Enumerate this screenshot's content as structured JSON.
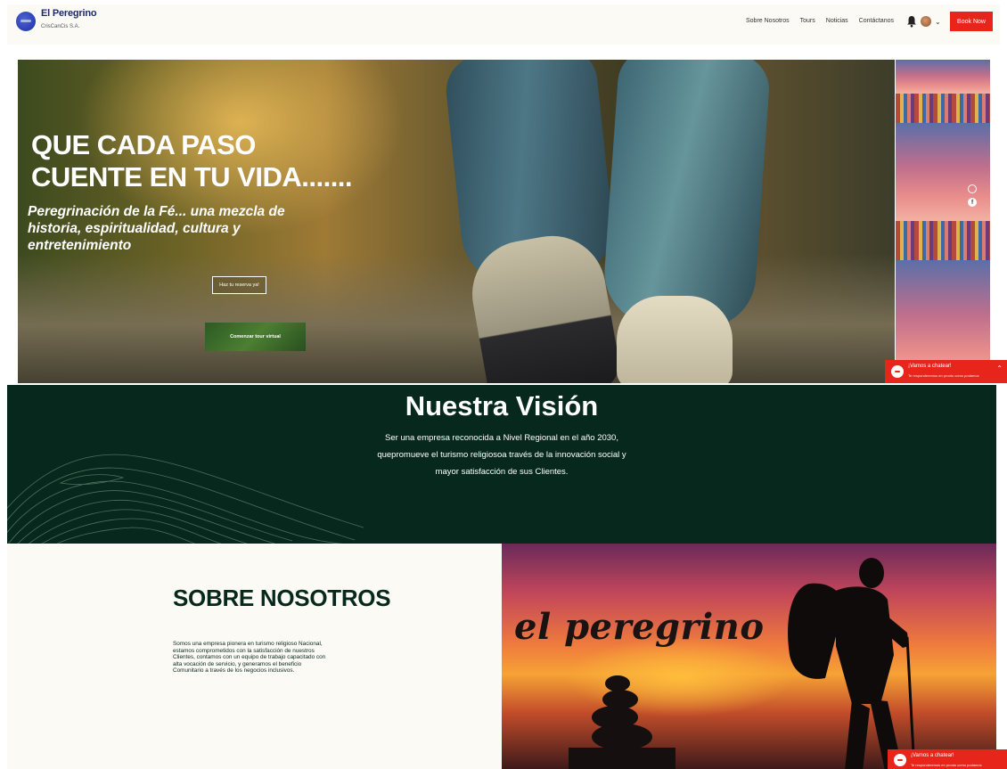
{
  "header": {
    "site_title": "El Peregrino",
    "site_subtitle": "CrisCanCis S.A.",
    "nav": [
      "Sobre Nosotros",
      "Tours",
      "Noticias",
      "Contáctanos"
    ],
    "book_now": "Book Now",
    "icons": {
      "notifications": "bell-icon",
      "account": "avatar",
      "menu": "chevron-down-icon"
    }
  },
  "hero": {
    "heading": "QUE CADA PASO CUENTE EN TU VIDA.......",
    "subheading": "Peregrinación de la Fé... una mezcla de historia, espiritualidad, cultura y entretenimiento",
    "reserve_button": "Haz tu reserva ya!",
    "tour_button": "Comenzar tour virtual",
    "social_icons": [
      "instagram-icon",
      "facebook-icon"
    ]
  },
  "chat": {
    "title": "¡Vamos a chatear!",
    "subtitle": "Te responderemos en pronto como podamos"
  },
  "vision": {
    "title": "Nuestra Visión",
    "text": "Ser una empresa reconocida a Nivel Regional en el año 2030, quepromueve el turismo religiosoa través de la innovación social y mayor satisfacción de sus Clientes."
  },
  "about": {
    "title": "SOBRE NOSOTROS",
    "text": "Somos una empresa pionera en turismo religioso Nacional, estamos comprometidos con la satisfacción de nuestros Clientes, contamos con un equipo de trabajo capacitado con alta vocación de servicio, y generamos el beneficio Comunitario a través de los negocios inclusivos.",
    "image_caption": "el peregrino"
  },
  "colors": {
    "accent": "#e8251a",
    "dark_green": "#07291d",
    "cream": "#fcfaf4"
  }
}
